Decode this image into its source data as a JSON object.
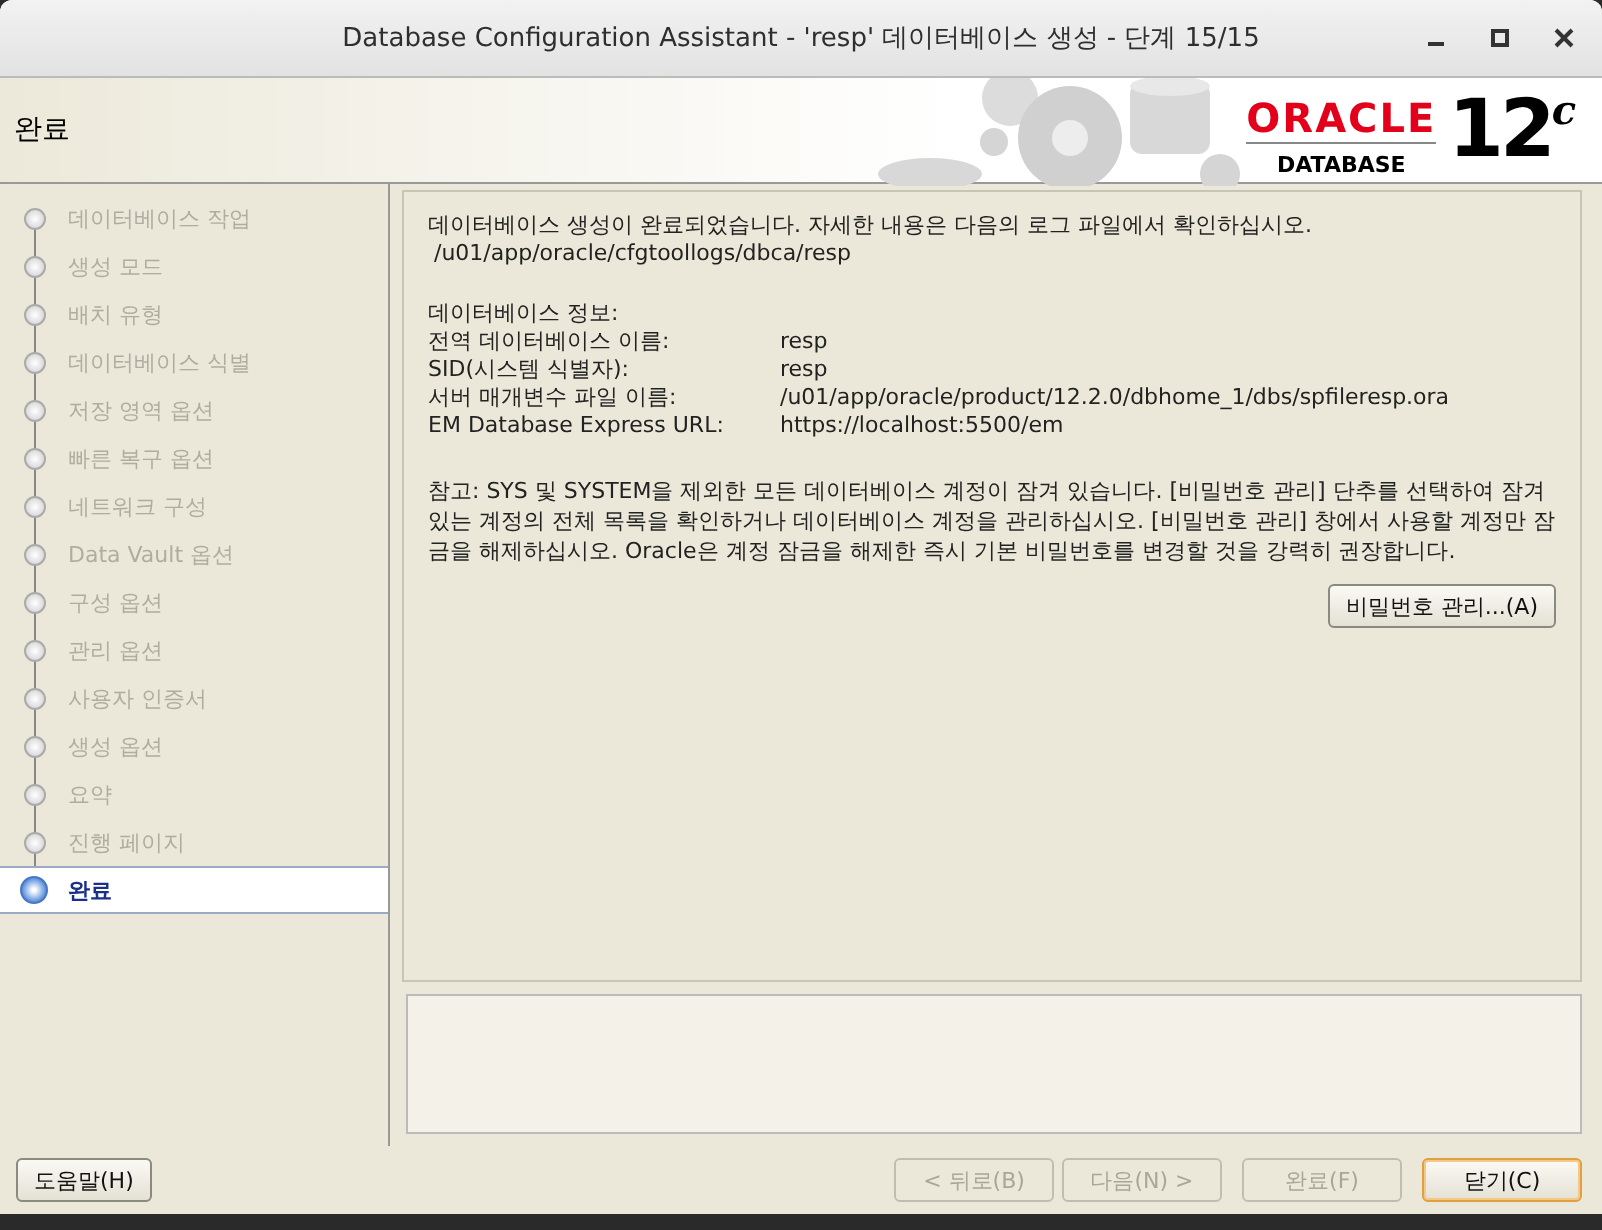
{
  "window": {
    "title": "Database Configuration Assistant - 'resp' 데이터베이스 생성 - 단계 15/15"
  },
  "header": {
    "title": "완료",
    "logo": {
      "brand": "ORACLE",
      "product": "DATABASE",
      "version": "12",
      "version_suffix": "c"
    }
  },
  "steps": [
    {
      "label": "데이터베이스 작업",
      "selected": false
    },
    {
      "label": "생성 모드",
      "selected": false
    },
    {
      "label": "배치 유형",
      "selected": false
    },
    {
      "label": "데이터베이스 식별",
      "selected": false
    },
    {
      "label": "저장 영역 옵션",
      "selected": false
    },
    {
      "label": "빠른 복구 옵션",
      "selected": false
    },
    {
      "label": "네트워크 구성",
      "selected": false
    },
    {
      "label": "Data Vault 옵션",
      "selected": false
    },
    {
      "label": "구성 옵션",
      "selected": false
    },
    {
      "label": "관리 옵션",
      "selected": false
    },
    {
      "label": "사용자 인증서",
      "selected": false
    },
    {
      "label": "생성 옵션",
      "selected": false
    },
    {
      "label": "요약",
      "selected": false
    },
    {
      "label": "진행 페이지",
      "selected": false
    },
    {
      "label": "완료",
      "selected": true
    }
  ],
  "content": {
    "message": "데이터베이스 생성이 완료되었습니다. 자세한 내용은 다음의 로그 파일에서 확인하십시오.",
    "log_path": "/u01/app/oracle/cfgtoollogs/dbca/resp",
    "info_heading": "데이터베이스 정보:",
    "info": [
      {
        "label": "전역 데이터베이스 이름:",
        "value": "resp"
      },
      {
        "label": "SID(시스템 식별자):",
        "value": "resp"
      },
      {
        "label": "서버 매개변수 파일 이름:",
        "value": "/u01/app/oracle/product/12.2.0/dbhome_1/dbs/spfileresp.ora"
      },
      {
        "label": "EM Database Express URL:",
        "value": "https://localhost:5500/em"
      }
    ],
    "note": "참고: SYS 및 SYSTEM을 제외한 모든 데이터베이스 계정이 잠겨 있습니다. [비밀번호 관리] 단추를 선택하여 잠겨 있는 계정의 전체 목록을 확인하거나 데이터베이스 계정을 관리하십시오. [비밀번호 관리] 창에서 사용할 계정만 잠금을 해제하십시오. Oracle은 계정 잠금을 해제한 즉시 기본 비밀번호를 변경할 것을 강력히 권장합니다.",
    "password_button": "비밀번호 관리...(A)"
  },
  "footer": {
    "help": "도움말(H)",
    "buttons": [
      {
        "label": "< 뒤로(B)",
        "disabled": true
      },
      {
        "label": "다음(N) >",
        "disabled": true
      },
      {
        "label": "완료(F)",
        "disabled": true
      },
      {
        "label": "닫기(C)",
        "disabled": false
      }
    ]
  }
}
